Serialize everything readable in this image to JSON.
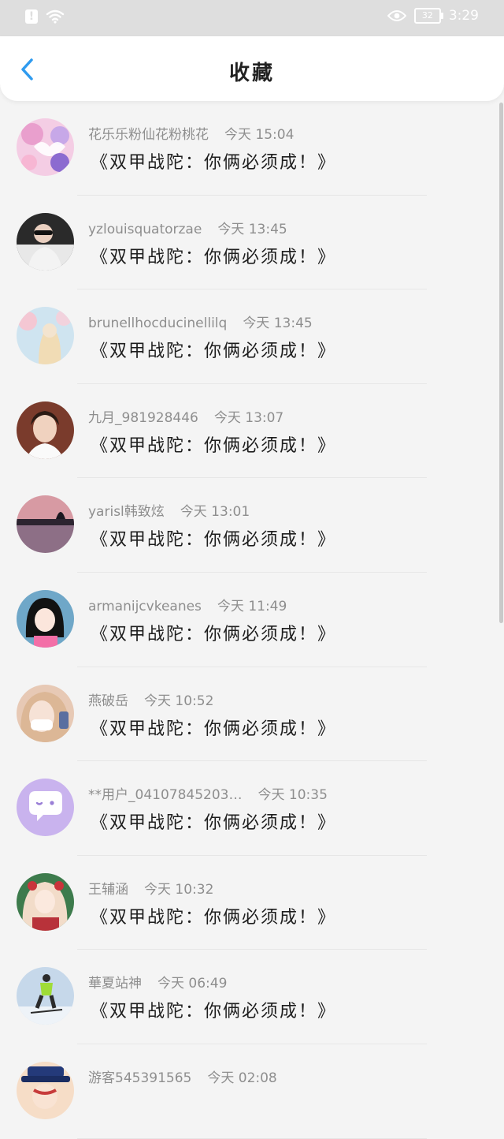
{
  "status_bar": {
    "time": "3:29",
    "battery": "32",
    "icons": [
      "alert-icon",
      "wifi-icon",
      "eye-icon",
      "battery-icon"
    ]
  },
  "header": {
    "title": "收藏",
    "back_icon": "chevron-left-icon"
  },
  "colors": {
    "accent": "#2f9bef",
    "status_bar_bg": "#dedede",
    "page_bg": "#f4f4f4"
  },
  "items": [
    {
      "user": "花乐乐粉仙花粉桃花",
      "time": "今天 15:04",
      "text": "《双甲战陀：你俩必须成！》",
      "avatar": "pink-collage-avatar"
    },
    {
      "user": "yzlouisquatorzae",
      "time": "今天 13:45",
      "text": "《双甲战陀：你俩必须成！》",
      "avatar": "person-sunglasses-avatar"
    },
    {
      "user": "brunellhocducinellilq",
      "time": "今天 13:45",
      "text": "《双甲战陀：你俩必须成！》",
      "avatar": "blossom-girl-avatar"
    },
    {
      "user": "九月_981928446",
      "time": "今天 13:07",
      "text": "《双甲战陀：你俩必须成！》",
      "avatar": "young-person-avatar"
    },
    {
      "user": "yarisl韩致炫",
      "time": "今天 13:01",
      "text": "《双甲战陀：你俩必须成！》",
      "avatar": "sunset-lake-avatar"
    },
    {
      "user": "armanijcvkeanes",
      "time": "今天 11:49",
      "text": "《双甲战陀：你俩必须成！》",
      "avatar": "cartoon-girl-avatar"
    },
    {
      "user": "燕破岳",
      "time": "今天 10:52",
      "text": "《双甲战陀：你俩必须成！》",
      "avatar": "masked-girl-avatar"
    },
    {
      "user": "**用户_04107845203…",
      "time": "今天 10:35",
      "text": "《双甲战陀：你俩必须成！》",
      "avatar": "chat-bubble-avatar"
    },
    {
      "user": "王辅涵",
      "time": "今天 10:32",
      "text": "《双甲战陀：你俩必须成！》",
      "avatar": "anime-girl-avatar"
    },
    {
      "user": "華夏站神",
      "time": "今天 06:49",
      "text": "《双甲战陀：你俩必须成！》",
      "avatar": "skier-avatar"
    },
    {
      "user": "游客545391565",
      "time": "今天 02:08",
      "text": "",
      "avatar": "hat-avatar"
    }
  ]
}
